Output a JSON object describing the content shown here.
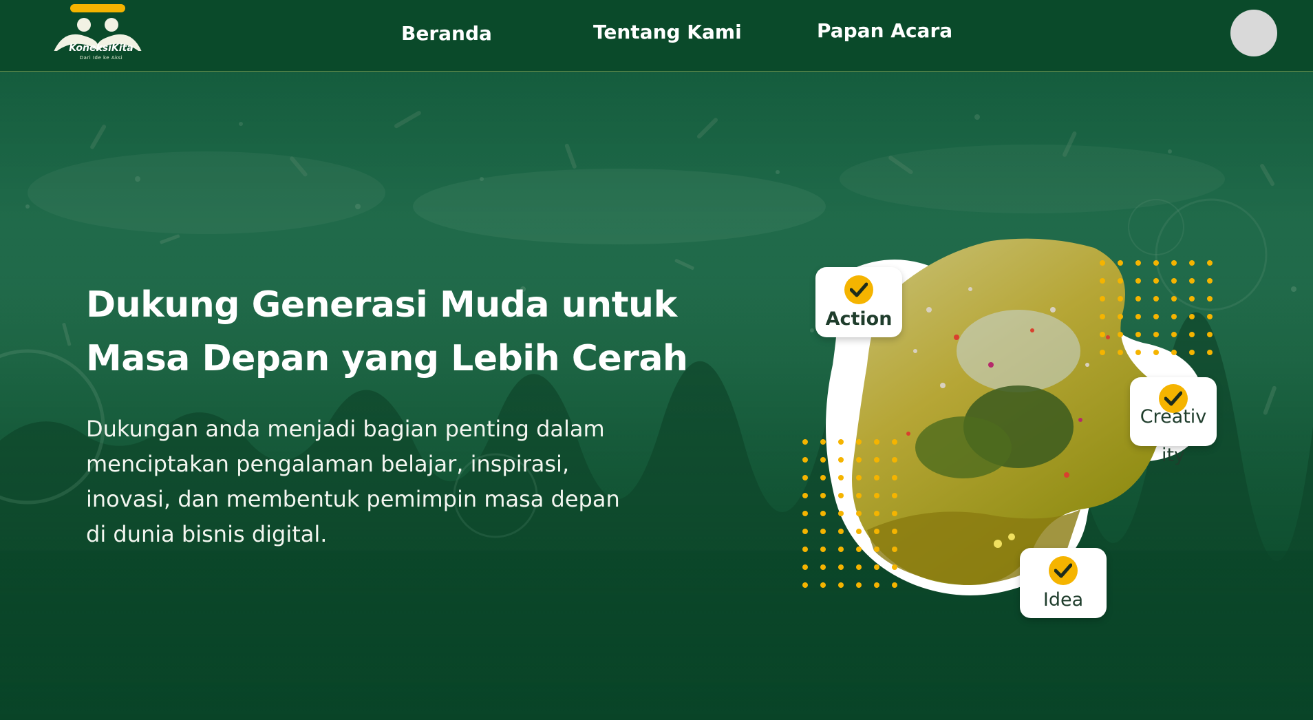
{
  "brand": {
    "name": "KoneksiKita",
    "tagline": "Dari Ide ke Aksi",
    "primary_color": "#0a4a2a",
    "accent_color": "#f5b400"
  },
  "nav": {
    "items": [
      {
        "label": "Beranda"
      },
      {
        "label": "Tentang Kami"
      },
      {
        "label": "Papan Acara"
      }
    ]
  },
  "hero": {
    "title_line1": "Dukung Generasi Muda untuk",
    "title_line2": "Masa Depan yang Lebih Cerah",
    "body_line1": "Dukungan anda menjadi bagian penting dalam",
    "body_line2": "menciptakan pengalaman belajar, inspirasi,",
    "body_line3": "inovasi, dan membentuk pemimpin masa depan",
    "body_line4": "di dunia bisnis digital."
  },
  "badges": {
    "action": "Action",
    "creativity_line1": "Creativ",
    "creativity_line2": "ity",
    "idea": "Idea"
  },
  "icons": [
    "logo-icon",
    "check-icon",
    "avatar"
  ]
}
